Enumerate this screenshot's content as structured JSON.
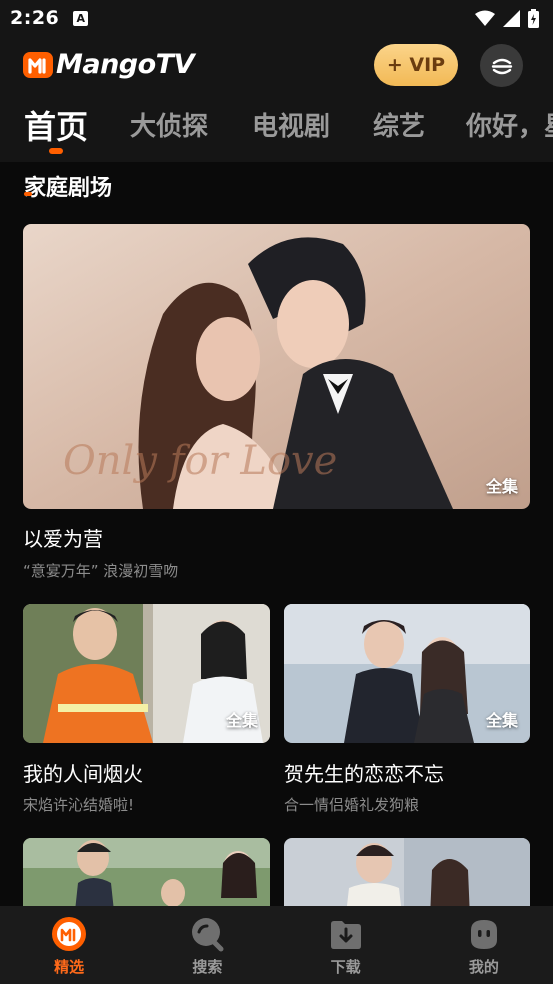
{
  "status": {
    "time": "2:26",
    "a_icon": "A"
  },
  "header": {
    "logo_text": "MangoTV",
    "vip_label": "+ VIP",
    "brand_color": "#ff5f00"
  },
  "tabs": [
    {
      "label": "首页",
      "active": true
    },
    {
      "label": "大侦探"
    },
    {
      "label": "电视剧"
    },
    {
      "label": "综艺"
    },
    {
      "label": "你好，星期六"
    }
  ],
  "section": {
    "title": "家庭剧场"
  },
  "featured": {
    "title": "以爱为营",
    "subtitle": "“意宴万年” 浪漫初雪吻",
    "badge": "全集",
    "overlay_text": "Only for Love"
  },
  "cards": [
    {
      "title": "我的人间烟火",
      "subtitle": "宋焰许沁结婚啦!",
      "badge": "全集"
    },
    {
      "title": "贺先生的恋恋不忘",
      "subtitle": "合一情侣婚礼发狗粮",
      "badge": "全集"
    }
  ],
  "nav": [
    {
      "label": "精选",
      "icon": "mango-home-icon",
      "active": true
    },
    {
      "label": "搜索",
      "icon": "search-icon"
    },
    {
      "label": "下载",
      "icon": "download-icon"
    },
    {
      "label": "我的",
      "icon": "profile-icon"
    }
  ]
}
